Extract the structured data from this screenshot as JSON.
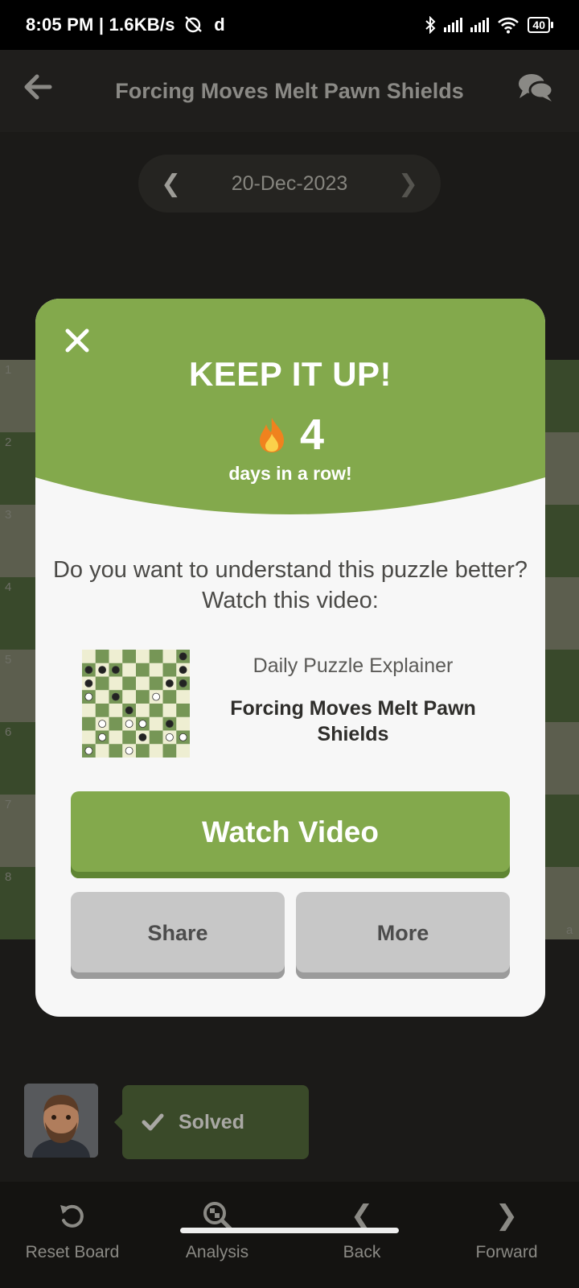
{
  "status_bar": {
    "time_speed": "8:05 PM | 1.6KB/s",
    "carrier_icon": "d",
    "battery": "40"
  },
  "header": {
    "title": "Forcing Moves Melt Pawn Shields"
  },
  "date_nav": {
    "date": "20-Dec-2023"
  },
  "board": {
    "ranks": [
      "1",
      "2",
      "3",
      "4",
      "5",
      "6",
      "7",
      "8"
    ],
    "file_label": "a"
  },
  "modal": {
    "heading": "KEEP IT UP!",
    "streak_count": "4",
    "streak_label": "days in a row!",
    "question": "Do you want to understand this puzzle better? Watch this video:",
    "video_subtitle": "Daily Puzzle Explainer",
    "video_title": "Forcing Moves Melt Pawn Shields",
    "watch_label": "Watch Video",
    "share_label": "Share",
    "more_label": "More"
  },
  "player": {
    "status": "Solved"
  },
  "bottom_nav": {
    "items": [
      {
        "label": "Reset Board",
        "icon": "reset-icon"
      },
      {
        "label": "Analysis",
        "icon": "analysis-icon"
      },
      {
        "label": "Back",
        "icon": "chevron-left-icon"
      },
      {
        "label": "Forward",
        "icon": "chevron-right-icon"
      }
    ]
  },
  "colors": {
    "accent_green": "#83a94c",
    "modal_bg": "#f7f7f7",
    "button_gray": "#c7c7c7"
  }
}
